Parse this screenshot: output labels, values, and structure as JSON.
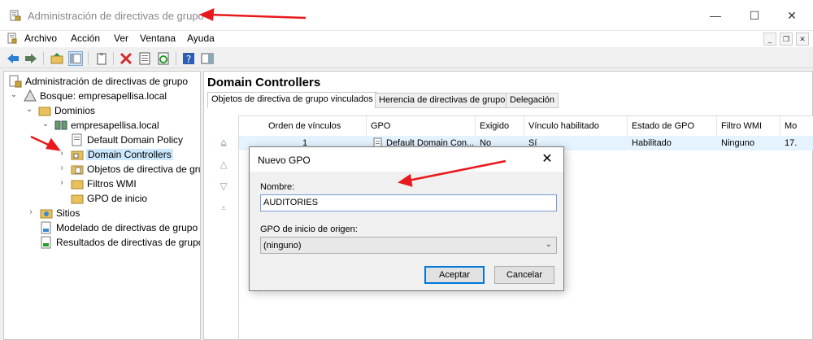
{
  "window": {
    "title": "Administración de directivas de grupo",
    "minimize": "—",
    "maximize": "☐",
    "close": "✕"
  },
  "menu": {
    "items": [
      "Archivo",
      "Acción",
      "Ver",
      "Ventana",
      "Ayuda"
    ],
    "mdi_minimize": "_",
    "mdi_restore": "❐",
    "mdi_close": "✕"
  },
  "tree": {
    "root": "Administración de directivas de grupo",
    "forest": "Bosque: empresapellisa.local",
    "domains": "Dominios",
    "domain": "empresapellisa.local",
    "default_policy": "Default Domain Policy",
    "domain_controllers": "Domain Controllers",
    "gpo_objects": "Objetos de directiva de gru",
    "wmi_filters": "Filtros WMI",
    "starter_gpo": "GPO de inicio",
    "sites": "Sitios",
    "modeling": "Modelado de directivas de grupo",
    "results": "Resultados de directivas de grupo"
  },
  "panel": {
    "heading": "Domain Controllers",
    "tabs": [
      "Objetos de directiva de grupo vinculados",
      "Herencia de directivas de grupo",
      "Delegación"
    ],
    "columns": [
      "Orden de vínculos",
      "GPO",
      "Exigido",
      "Vínculo habilitado",
      "Estado de GPO",
      "Filtro WMI",
      "Mo"
    ],
    "rows": [
      [
        "1",
        "Default Domain Con...",
        "No",
        "Sí",
        "Habilitado",
        "Ninguno",
        "17."
      ]
    ]
  },
  "dialog": {
    "title": "Nuevo GPO",
    "close": "✕",
    "name_label": "Nombre:",
    "name_value": "AUDITORIES",
    "source_label": "GPO de inicio de origen:",
    "source_value": "(ninguno)",
    "ok": "Aceptar",
    "cancel": "Cancelar"
  },
  "colors": {
    "selection": "#cce8ff",
    "annotation_arrow": "#e8191c",
    "focus_border": "#0078d7"
  }
}
